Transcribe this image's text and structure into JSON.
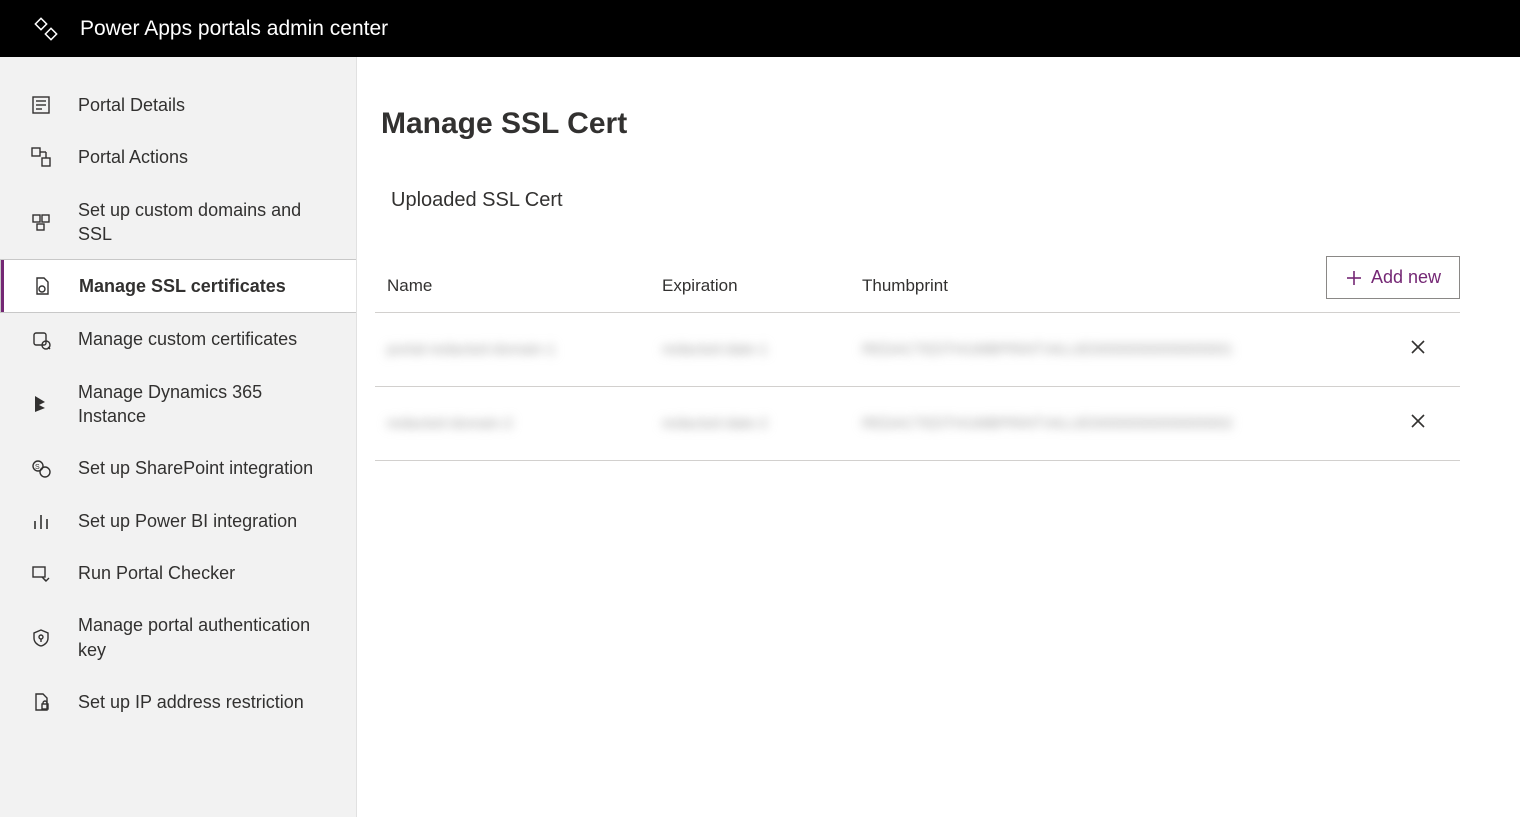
{
  "header": {
    "title": "Power Apps portals admin center"
  },
  "sidebar": {
    "items": [
      {
        "label": "Portal Details",
        "icon": "details-icon",
        "selected": false
      },
      {
        "label": "Portal Actions",
        "icon": "actions-icon",
        "selected": false
      },
      {
        "label": "Set up custom domains and SSL",
        "icon": "domains-icon",
        "selected": false
      },
      {
        "label": "Manage SSL certificates",
        "icon": "cert-icon",
        "selected": true
      },
      {
        "label": "Manage custom certificates",
        "icon": "custom-cert-icon",
        "selected": false
      },
      {
        "label": "Manage Dynamics 365 Instance",
        "icon": "dynamics-icon",
        "selected": false
      },
      {
        "label": "Set up SharePoint integration",
        "icon": "sharepoint-icon",
        "selected": false
      },
      {
        "label": "Set up Power BI integration",
        "icon": "powerbi-icon",
        "selected": false
      },
      {
        "label": "Run Portal Checker",
        "icon": "checker-icon",
        "selected": false
      },
      {
        "label": "Manage portal authentication key",
        "icon": "auth-key-icon",
        "selected": false
      },
      {
        "label": "Set up IP address restriction",
        "icon": "ip-restriction-icon",
        "selected": false
      }
    ]
  },
  "main": {
    "page_title": "Manage SSL Cert",
    "section_title": "Uploaded SSL Cert",
    "add_label": "Add new",
    "columns": {
      "name": "Name",
      "expiration": "Expiration",
      "thumbprint": "Thumbprint"
    },
    "rows": [
      {
        "name": "portal-redacted-domain-1",
        "expiration": "redacted-date-1",
        "thumbprint": "REDACTEDTHUMBPRINTVALUE00000000000000001"
      },
      {
        "name": "redacted-domain-2",
        "expiration": "redacted-date-2",
        "thumbprint": "REDACTEDTHUMBPRINTVALUE00000000000000002"
      }
    ]
  },
  "colors": {
    "accent": "#742774"
  }
}
